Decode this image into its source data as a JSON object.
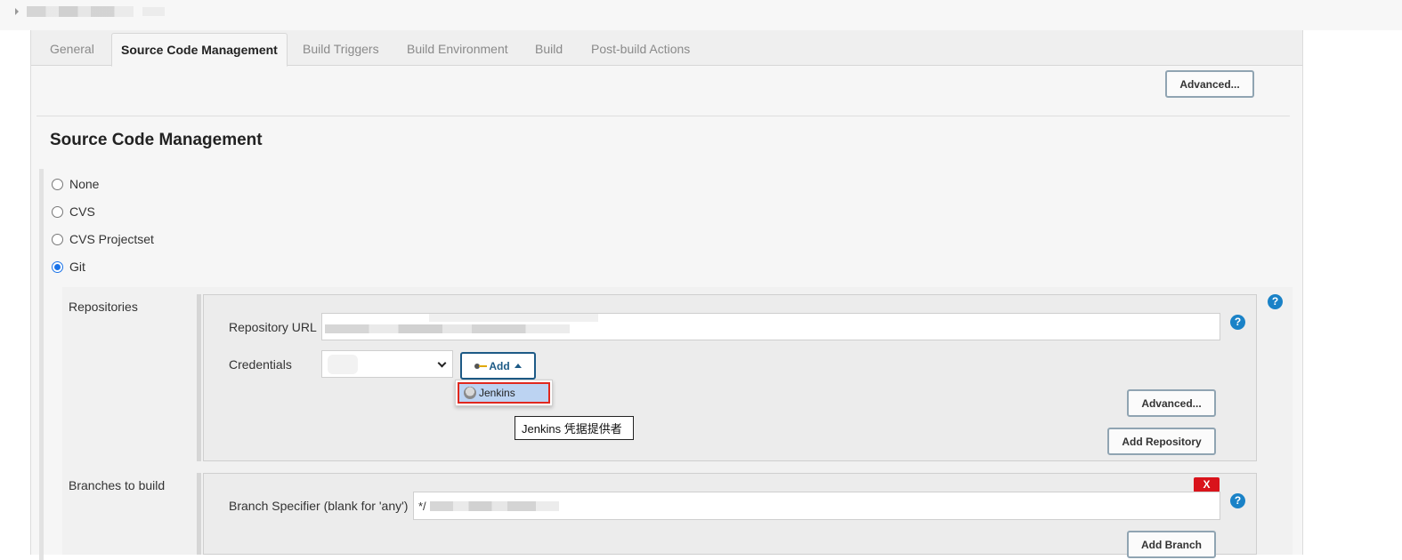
{
  "tabs": [
    {
      "label": "General"
    },
    {
      "label": "Source Code Management"
    },
    {
      "label": "Build Triggers"
    },
    {
      "label": "Build Environment"
    },
    {
      "label": "Build"
    },
    {
      "label": "Post-build Actions"
    }
  ],
  "active_tab": "Source Code Management",
  "top_advanced_label": "Advanced...",
  "section_title": "Source Code Management",
  "scm_options": [
    {
      "label": "None",
      "checked": false
    },
    {
      "label": "CVS",
      "checked": false
    },
    {
      "label": "CVS Projectset",
      "checked": false
    },
    {
      "label": "Git",
      "checked": true
    }
  ],
  "repositories": {
    "label": "Repositories",
    "repo_url_label": "Repository URL",
    "repo_url_value": "",
    "credentials_label": "Credentials",
    "add_button_label": "Add",
    "dropdown_items": [
      {
        "label": "Jenkins"
      }
    ],
    "tooltip_text": "Jenkins 凭据提供者",
    "advanced_label": "Advanced...",
    "add_repository_label": "Add Repository"
  },
  "branches": {
    "label": "Branches to build",
    "specifier_label": "Branch Specifier (blank for 'any')",
    "specifier_value": "*/",
    "delete_label": "X",
    "add_branch_label": "Add Branch"
  },
  "help_icon_glyph": "?",
  "colors": {
    "accent_blue": "#1a82c7",
    "add_border": "#1d5a86",
    "highlight_red": "#e0281e",
    "delete_red": "#d9131b",
    "dropdown_selected": "#bcd3f2"
  }
}
